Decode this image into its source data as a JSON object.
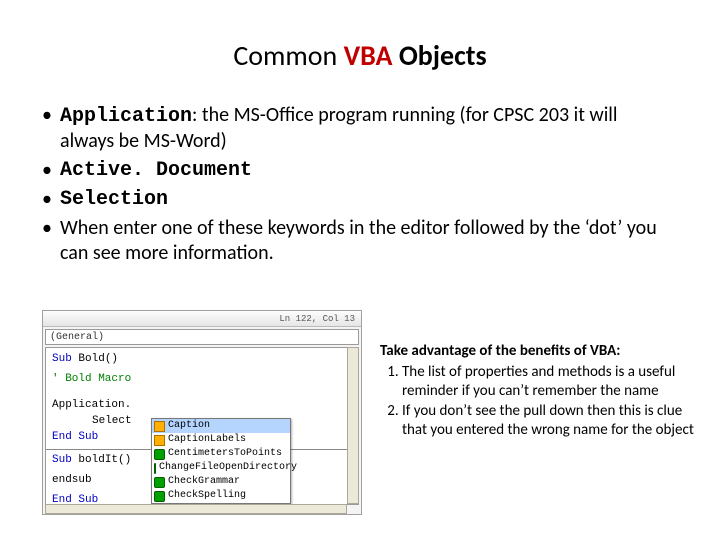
{
  "title": {
    "common": "Common ",
    "vba": "VBA",
    "objects": " Objects"
  },
  "bullets": {
    "b1_label": "Application",
    "b1_rest": ": the MS-Office program running (for CPSC 203 it will always be MS-Word)",
    "b2": "Active. Document",
    "b3": "Selection",
    "b4": "When enter one of these keywords in the editor followed by the ‘dot’ you can see more information."
  },
  "editor": {
    "status": "Ln 122, Col 13",
    "combo": "(General)",
    "lines": {
      "l1a": "Sub",
      "l1b": " Bold()",
      "l2": "' Bold Macro",
      "l3": "Application.",
      "l4": "Select",
      "l5a": "End Sub",
      "l6a": "Sub",
      "l6b": " boldIt()",
      "l7": "endsub",
      "l8": "End Sub"
    },
    "intellisense": {
      "i1": "Caption",
      "i2": "CaptionLabels",
      "i3": "CentimetersToPoints",
      "i4": "ChangeFileOpenDirectory",
      "i5": "CheckGrammar",
      "i6": "CheckSpelling"
    }
  },
  "benefits": {
    "lead": "Take advantage of the benefits of VBA:",
    "p1": "The list of properties and methods is a useful reminder if you can’t remember the name",
    "p2": "If you don’t see the pull down then this is clue that you entered the wrong name for the object"
  }
}
